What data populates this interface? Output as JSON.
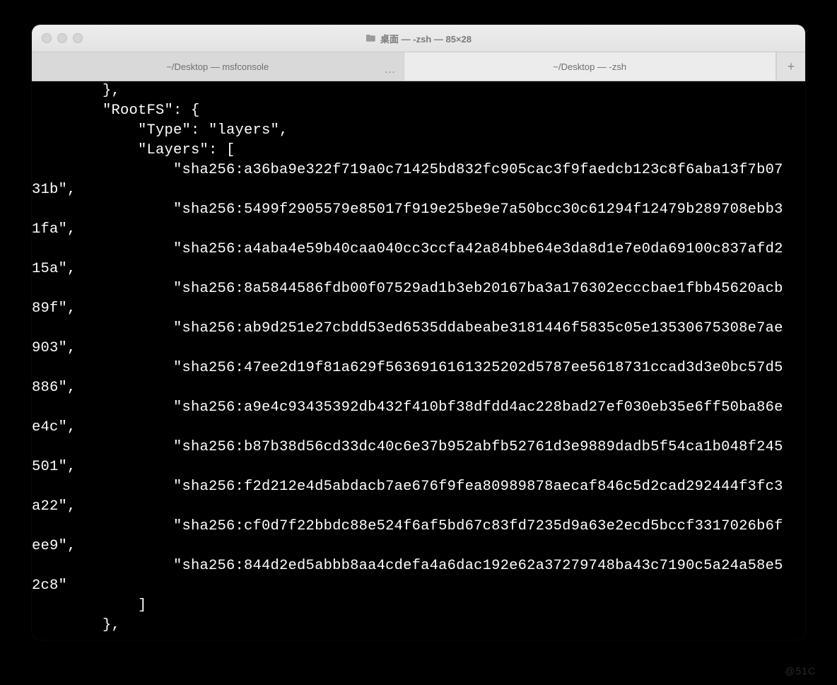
{
  "window": {
    "title": "桌面 — -zsh — 85×28"
  },
  "tabs": {
    "left": "~/Desktop — msfconsole",
    "right": "~/Desktop — -zsh",
    "overflow": "…",
    "new_tab": "+"
  },
  "watermark": "@51C​",
  "terminal_prefix_lines": [
    "        },",
    "        \"RootFS\": {",
    "            \"Type\": \"layers\",",
    "            \"Layers\": ["
  ],
  "terminal_layers": [
    "sha256:a36ba9e322f719a0c71425bd832fc905cac3f9faedcb123c8f6aba13f7b0731b",
    "sha256:5499f2905579e85017f919e25be9e7a50bcc30c61294f12479b289708ebb31fa",
    "sha256:a4aba4e59b40caa040cc3ccfa42a84bbe64e3da8d1e7e0da69100c837afd215a",
    "sha256:8a5844586fdb00f07529ad1b3eb20167ba3a176302ecccbae1fbb45620acb89f",
    "sha256:ab9d251e27cbdd53ed6535ddabeabe3181446f5835c05e13530675308e7ae903",
    "sha256:47ee2d19f81a629f5636916161325202d5787ee5618731ccad3d3e0bc57d5886",
    "sha256:a9e4c93435392db432f410bf38dfdd4ac228bad27ef030eb35e6ff50ba86ee4c",
    "sha256:b87b38d56cd33dc40c6e37b952abfb52761d3e9889dadb5f54ca1b048f245501",
    "sha256:f2d212e4d5abdacb7ae676f9fea80989878aecaf846c5d2cad292444f3fc3a22",
    "sha256:cf0d7f22bbdc88e524f6af5bd67c83fd7235d9a63e2ecd5bccf3317026b6fee9",
    "sha256:844d2ed5abbb8aa4cdefa4a6dac192e62a37279748ba43c7190c5a24a58e52c8"
  ],
  "terminal_suffix_lines": [
    "            ]",
    "        },"
  ],
  "terminal_layout": {
    "columns": 85,
    "indent": "                "
  }
}
